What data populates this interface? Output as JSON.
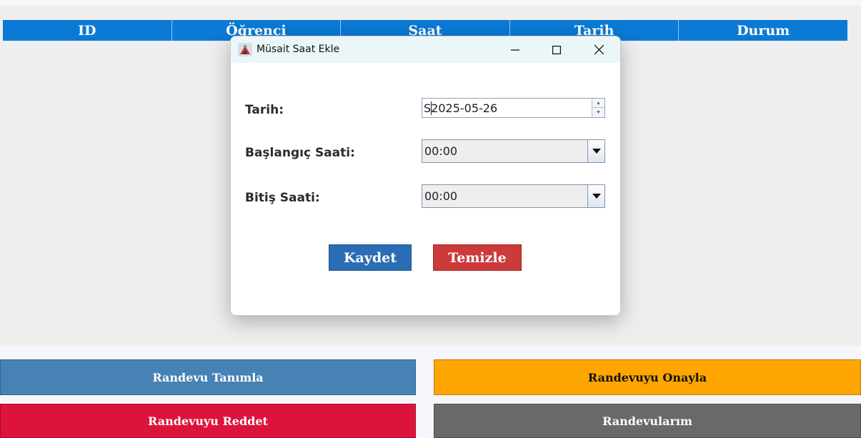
{
  "table": {
    "columns": [
      "ID",
      "Öğrenci",
      "Saat",
      "Tarih",
      "Durum"
    ]
  },
  "dialog": {
    "title": "Müsait Saat Ekle",
    "fields": {
      "date_label": "Tarih:",
      "date_value": "S2025-05-26",
      "start_label": "Başlangıç Saati:",
      "start_value": "00:00",
      "end_label": "Bitiş Saati:",
      "end_value": "00:00"
    },
    "buttons": {
      "save": "Kaydet",
      "clear": "Temizle"
    }
  },
  "actions": {
    "define": "Randevu Tanımla",
    "approve": "Randevuyu Onayla",
    "reject": "Randevuyu Reddet",
    "mine": "Randevularım"
  },
  "colors": {
    "table_header": "#0a7ad6",
    "define": "#4682b4",
    "approve": "#ffa500",
    "reject": "#dc143c",
    "mine": "#696969",
    "save": "#2a6db5",
    "clear": "#cc3a3a"
  },
  "icons": {
    "app": "java-app-icon",
    "minimize": "minimize-icon",
    "maximize": "maximize-icon",
    "close": "close-icon",
    "dropdown": "chevron-down-icon"
  }
}
